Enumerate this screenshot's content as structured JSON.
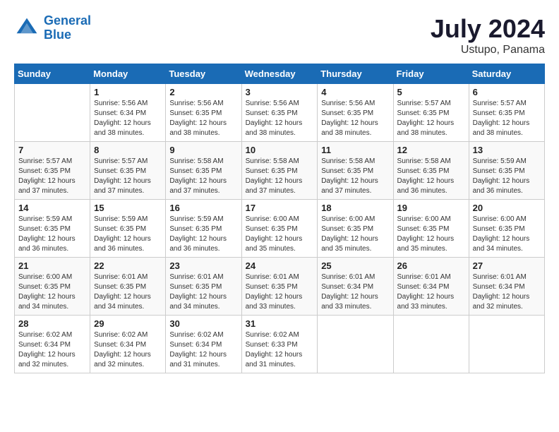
{
  "header": {
    "logo_line1": "General",
    "logo_line2": "Blue",
    "month": "July 2024",
    "location": "Ustupo, Panama"
  },
  "weekdays": [
    "Sunday",
    "Monday",
    "Tuesday",
    "Wednesday",
    "Thursday",
    "Friday",
    "Saturday"
  ],
  "weeks": [
    [
      {
        "day": "",
        "info": ""
      },
      {
        "day": "1",
        "info": "Sunrise: 5:56 AM\nSunset: 6:34 PM\nDaylight: 12 hours\nand 38 minutes."
      },
      {
        "day": "2",
        "info": "Sunrise: 5:56 AM\nSunset: 6:35 PM\nDaylight: 12 hours\nand 38 minutes."
      },
      {
        "day": "3",
        "info": "Sunrise: 5:56 AM\nSunset: 6:35 PM\nDaylight: 12 hours\nand 38 minutes."
      },
      {
        "day": "4",
        "info": "Sunrise: 5:56 AM\nSunset: 6:35 PM\nDaylight: 12 hours\nand 38 minutes."
      },
      {
        "day": "5",
        "info": "Sunrise: 5:57 AM\nSunset: 6:35 PM\nDaylight: 12 hours\nand 38 minutes."
      },
      {
        "day": "6",
        "info": "Sunrise: 5:57 AM\nSunset: 6:35 PM\nDaylight: 12 hours\nand 38 minutes."
      }
    ],
    [
      {
        "day": "7",
        "info": "Sunrise: 5:57 AM\nSunset: 6:35 PM\nDaylight: 12 hours\nand 37 minutes."
      },
      {
        "day": "8",
        "info": "Sunrise: 5:57 AM\nSunset: 6:35 PM\nDaylight: 12 hours\nand 37 minutes."
      },
      {
        "day": "9",
        "info": "Sunrise: 5:58 AM\nSunset: 6:35 PM\nDaylight: 12 hours\nand 37 minutes."
      },
      {
        "day": "10",
        "info": "Sunrise: 5:58 AM\nSunset: 6:35 PM\nDaylight: 12 hours\nand 37 minutes."
      },
      {
        "day": "11",
        "info": "Sunrise: 5:58 AM\nSunset: 6:35 PM\nDaylight: 12 hours\nand 37 minutes."
      },
      {
        "day": "12",
        "info": "Sunrise: 5:58 AM\nSunset: 6:35 PM\nDaylight: 12 hours\nand 36 minutes."
      },
      {
        "day": "13",
        "info": "Sunrise: 5:59 AM\nSunset: 6:35 PM\nDaylight: 12 hours\nand 36 minutes."
      }
    ],
    [
      {
        "day": "14",
        "info": "Sunrise: 5:59 AM\nSunset: 6:35 PM\nDaylight: 12 hours\nand 36 minutes."
      },
      {
        "day": "15",
        "info": "Sunrise: 5:59 AM\nSunset: 6:35 PM\nDaylight: 12 hours\nand 36 minutes."
      },
      {
        "day": "16",
        "info": "Sunrise: 5:59 AM\nSunset: 6:35 PM\nDaylight: 12 hours\nand 36 minutes."
      },
      {
        "day": "17",
        "info": "Sunrise: 6:00 AM\nSunset: 6:35 PM\nDaylight: 12 hours\nand 35 minutes."
      },
      {
        "day": "18",
        "info": "Sunrise: 6:00 AM\nSunset: 6:35 PM\nDaylight: 12 hours\nand 35 minutes."
      },
      {
        "day": "19",
        "info": "Sunrise: 6:00 AM\nSunset: 6:35 PM\nDaylight: 12 hours\nand 35 minutes."
      },
      {
        "day": "20",
        "info": "Sunrise: 6:00 AM\nSunset: 6:35 PM\nDaylight: 12 hours\nand 34 minutes."
      }
    ],
    [
      {
        "day": "21",
        "info": "Sunrise: 6:00 AM\nSunset: 6:35 PM\nDaylight: 12 hours\nand 34 minutes."
      },
      {
        "day": "22",
        "info": "Sunrise: 6:01 AM\nSunset: 6:35 PM\nDaylight: 12 hours\nand 34 minutes."
      },
      {
        "day": "23",
        "info": "Sunrise: 6:01 AM\nSunset: 6:35 PM\nDaylight: 12 hours\nand 34 minutes."
      },
      {
        "day": "24",
        "info": "Sunrise: 6:01 AM\nSunset: 6:35 PM\nDaylight: 12 hours\nand 33 minutes."
      },
      {
        "day": "25",
        "info": "Sunrise: 6:01 AM\nSunset: 6:34 PM\nDaylight: 12 hours\nand 33 minutes."
      },
      {
        "day": "26",
        "info": "Sunrise: 6:01 AM\nSunset: 6:34 PM\nDaylight: 12 hours\nand 33 minutes."
      },
      {
        "day": "27",
        "info": "Sunrise: 6:01 AM\nSunset: 6:34 PM\nDaylight: 12 hours\nand 32 minutes."
      }
    ],
    [
      {
        "day": "28",
        "info": "Sunrise: 6:02 AM\nSunset: 6:34 PM\nDaylight: 12 hours\nand 32 minutes."
      },
      {
        "day": "29",
        "info": "Sunrise: 6:02 AM\nSunset: 6:34 PM\nDaylight: 12 hours\nand 32 minutes."
      },
      {
        "day": "30",
        "info": "Sunrise: 6:02 AM\nSunset: 6:34 PM\nDaylight: 12 hours\nand 31 minutes."
      },
      {
        "day": "31",
        "info": "Sunrise: 6:02 AM\nSunset: 6:33 PM\nDaylight: 12 hours\nand 31 minutes."
      },
      {
        "day": "",
        "info": ""
      },
      {
        "day": "",
        "info": ""
      },
      {
        "day": "",
        "info": ""
      }
    ]
  ]
}
